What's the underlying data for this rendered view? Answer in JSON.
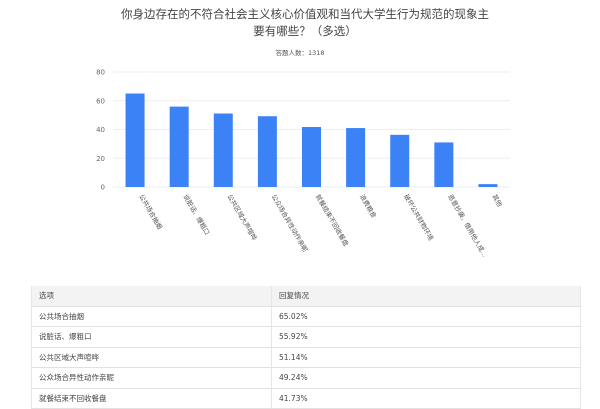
{
  "question": {
    "title": "你身边存在的不符合社会主义核心价值观和当代大学生行为规范的现象主要有哪些？（多选）",
    "respondents": "答题人数：1318"
  },
  "colors": {
    "bar": "#3b82f6",
    "grid": "#eeeeee"
  },
  "chart_data": {
    "type": "bar",
    "categories": [
      "公共场合抽烟",
      "说脏话、爆粗口",
      "公共区域大声喧哗",
      "公众场合异性动作亲昵",
      "就餐结束不回收餐盘",
      "浪费粮食",
      "破坏公共财物环境",
      "恶意抄袭、借用他人成...",
      "其他"
    ],
    "values": [
      65.02,
      55.92,
      51.14,
      49.24,
      41.73,
      41.0,
      36.3,
      31.0,
      2.0
    ],
    "ylim": [
      0,
      80
    ],
    "yticks": [
      0,
      20,
      40,
      60,
      80
    ],
    "grid": true,
    "title": "",
    "xlabel": "",
    "ylabel": ""
  },
  "table": {
    "headers": [
      "选项",
      "回复情况"
    ],
    "rows": [
      [
        "公共场合抽烟",
        "65.02%"
      ],
      [
        "说脏话、爆粗口",
        "55.92%"
      ],
      [
        "公共区域大声喧哗",
        "51.14%"
      ],
      [
        "公众场合异性动作亲昵",
        "49.24%"
      ],
      [
        "就餐结束不回收餐盘",
        "41.73%"
      ]
    ]
  }
}
